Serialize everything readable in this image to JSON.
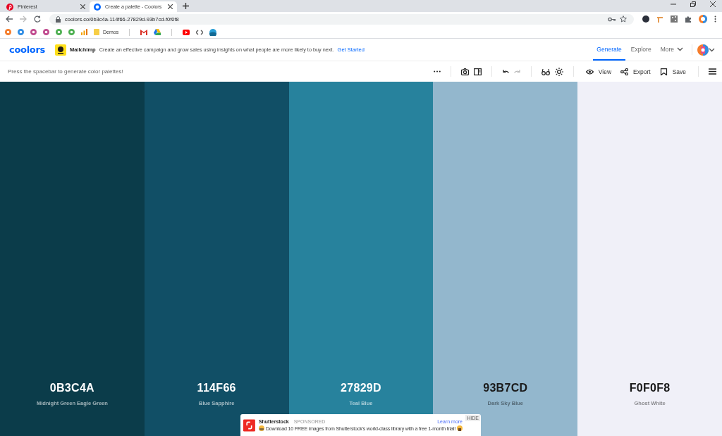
{
  "browser": {
    "tabs": [
      {
        "title": "Pinterest",
        "kind": "pin",
        "selected": false
      },
      {
        "title": "Create a palette - Coolors",
        "kind": "coolors",
        "selected": true
      }
    ],
    "address": "coolors.co/0b3c4a-114f66-27829d-93b7cd-f0f0f8",
    "bookmark_folder": "Demos"
  },
  "header": {
    "logo": "coolors",
    "ad": {
      "brand": "Mailchimp",
      "text": "Create an effective campaign and grow sales using insights on what people are more likely to buy next.",
      "link": "Get Started"
    },
    "nav": [
      {
        "label": "Generate",
        "selected": true
      },
      {
        "label": "Explore",
        "selected": false
      },
      {
        "label": "More",
        "selected": false
      }
    ]
  },
  "toolbar": {
    "hint": "Press the spacebar to generate color palettes!",
    "actions": [
      {
        "kind": "view",
        "label": "View"
      },
      {
        "kind": "export",
        "label": "Export"
      },
      {
        "kind": "save",
        "label": "Save"
      }
    ]
  },
  "palette": [
    {
      "hex": "0B3C4A",
      "name": "Midnight Green Eagle Green",
      "color": "#0b3c4a"
    },
    {
      "hex": "114F66",
      "name": "Blue Sapphire",
      "color": "#114f66"
    },
    {
      "hex": "27829D",
      "name": "Teal Blue",
      "color": "#27829d"
    },
    {
      "hex": "93B7CD",
      "name": "Dark Sky Blue",
      "color": "#93b7cd"
    },
    {
      "hex": "F0F0F8",
      "name": "Ghost White",
      "color": "#f0f0f8"
    }
  ],
  "popup_ad": {
    "brand": "Shutterstock",
    "tag": "SPONSORED",
    "message": "Download 10 FREE images from Shutterstock's world-class library with a free 1-month trial!",
    "link": "Learn more",
    "hide": "HIDE"
  }
}
